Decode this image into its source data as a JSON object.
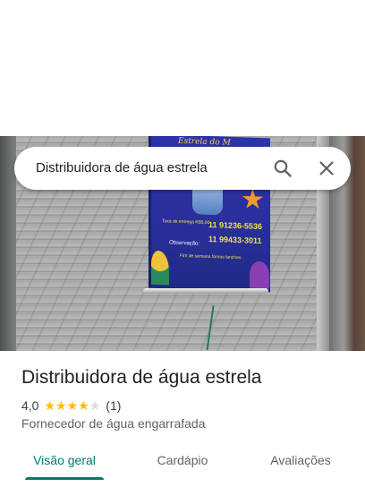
{
  "search": {
    "query": "Distribuidora de água estrela"
  },
  "photo": {
    "banner_title": "Estrela do M",
    "banner_small": "Taxa de entrega R$5,00",
    "banner_phone1": "11 91236-5536",
    "banner_phone2": "11 99433-3011",
    "banner_obs": "Observação:",
    "banner_fim": "Fim de semana fornos lanches"
  },
  "place": {
    "title": "Distribuidora de água estrela",
    "rating_value": "4,0",
    "rating_stars": 4,
    "rating_max": 5,
    "rating_count": "(1)",
    "category": "Fornecedor de água engarrafada"
  },
  "tabs": [
    {
      "label": "Visão geral",
      "active": true
    },
    {
      "label": "Cardápio",
      "active": false
    },
    {
      "label": "Avaliações",
      "active": false
    }
  ],
  "colors": {
    "accent": "#01796f",
    "star": "#fbbc04",
    "star_empty": "#dadce0"
  },
  "icons": {
    "search": "search-icon",
    "close": "close-icon"
  }
}
